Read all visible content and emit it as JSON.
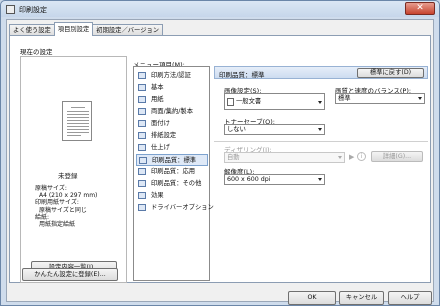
{
  "window": {
    "title": "印刷設定",
    "close": "✕"
  },
  "tabs": [
    "よく使う設定",
    "項目別設定",
    "初期設定／バージョン"
  ],
  "left": {
    "current_label": "現在の設定",
    "status": "未登録",
    "info": [
      "原稿サイズ:",
      "A4 (210 x 297 mm)",
      "印刷用紙サイズ:",
      "原稿サイズと同じ",
      "給紙:",
      "用紙指定給紙"
    ],
    "list_button": "設定内容一覧(I)...",
    "register_button": "かんたん設定に登録(E)..."
  },
  "menu": {
    "label": "メニュー項目(M):",
    "items": [
      "印刷方法/認証",
      "基本",
      "用紙",
      "両面/集約/製本",
      "面付け",
      "排紙設定",
      "仕上げ",
      "印刷品質：標準",
      "印刷品質：応用",
      "印刷品質：その他",
      "効果",
      "ドライバーオプション"
    ],
    "selected_index": 7
  },
  "detail": {
    "header": "印刷品質：標準",
    "restore_button": "標準に戻す(D)",
    "doc_type_label": "画像設定(S):",
    "doc_type_value": "一般文書",
    "quality_label": "画質と速度のバランス(P):",
    "quality_value": "標準",
    "toner_label": "トナーセーブ(O):",
    "toner_value": "しない",
    "dither_label": "ディザリング(I):",
    "dither_value": "自動",
    "detail_button": "詳細(G)...",
    "resolution_label": "解像度(L):",
    "resolution_value": "600 x 600 dpi"
  },
  "buttons": {
    "ok": "OK",
    "cancel": "キャンセル",
    "help": "ヘルプ"
  }
}
